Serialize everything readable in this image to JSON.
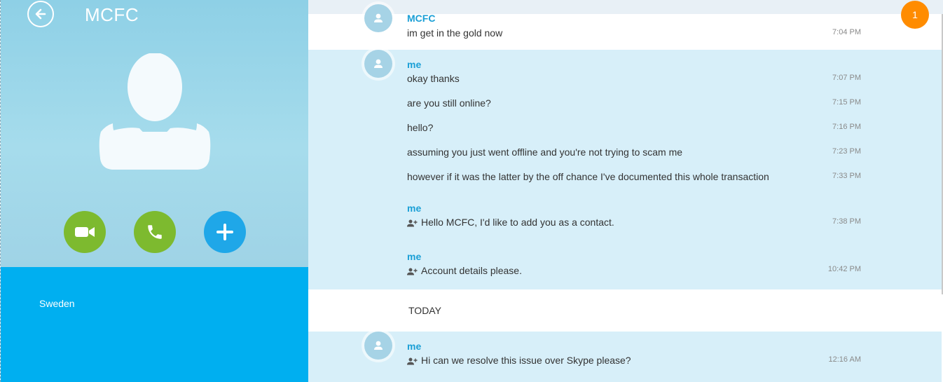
{
  "contact": {
    "name": "MCFC",
    "location": "Sweden"
  },
  "icons": {
    "back": "back-arrow-icon",
    "video": "video-camera-icon",
    "call": "phone-icon",
    "add": "plus-icon",
    "avatar": "person-icon",
    "contact_request": "add-contact-icon"
  },
  "colors": {
    "accent": "#00aff0",
    "call_green": "#7dba2f",
    "badge_orange": "#ff8c00",
    "sender_blue": "#1a9fd6"
  },
  "notifications": {
    "count": "1"
  },
  "conversation": {
    "groups": [
      {
        "sender": "MCFC",
        "messages": [
          {
            "text": "im get in the gold now",
            "time": "7:04 PM"
          }
        ]
      },
      {
        "sender": "me",
        "messages": [
          {
            "text": "okay thanks",
            "time": "7:07 PM"
          },
          {
            "text": "are you still online?",
            "time": "7:15 PM"
          },
          {
            "text": "hello?",
            "time": "7:16 PM"
          },
          {
            "text": "assuming you just went offline and you're not trying to scam me",
            "time": "7:23 PM"
          },
          {
            "text": "however if it was the latter by the off chance I've documented this whole transaction",
            "time": "7:33 PM"
          }
        ]
      },
      {
        "sender": "me",
        "messages": [
          {
            "text": "Hello MCFC, I'd like to add you as a contact.",
            "time": "7:38 PM"
          }
        ]
      },
      {
        "sender": "me",
        "messages": [
          {
            "text": "Account details please.",
            "time": "10:42 PM"
          }
        ]
      }
    ],
    "day_label": "TODAY",
    "today_groups": [
      {
        "sender": "me",
        "messages": [
          {
            "text": "Hi can we resolve this issue over Skype please?",
            "time": "12:16 AM"
          }
        ]
      }
    ]
  }
}
